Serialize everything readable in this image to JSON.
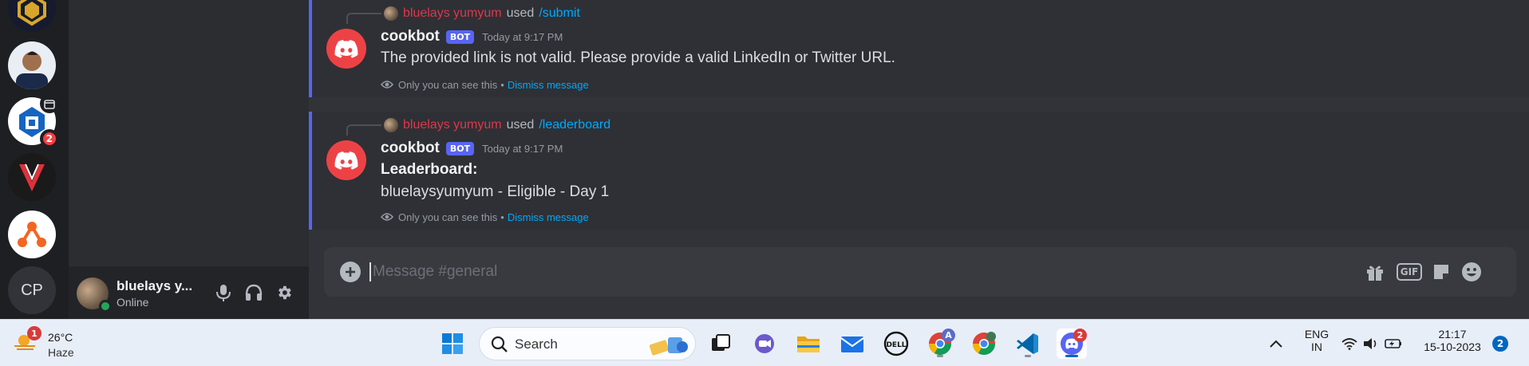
{
  "server_rail": {
    "items": [
      {
        "name": "server-gold-shield"
      },
      {
        "name": "server-profile-photo"
      },
      {
        "name": "server-blue-logo",
        "badge": "2"
      },
      {
        "name": "server-v-logo"
      },
      {
        "name": "server-orange-network"
      },
      {
        "name": "server-cp",
        "initials": "CP"
      }
    ]
  },
  "user_panel": {
    "name": "bluelays y...",
    "status": "Online"
  },
  "messages": [
    {
      "reply_user": "bluelays yumyum",
      "reply_used": "used",
      "reply_command": "/submit",
      "author": "cookbot",
      "bot_tag": "BOT",
      "timestamp": "Today at 9:17 PM",
      "lines": [
        "The provided link is not valid. Please provide a valid LinkedIn or Twitter URL."
      ],
      "ephemeral_note": "Only you can see this",
      "separator": "•",
      "dismiss": "Dismiss message"
    },
    {
      "reply_user": "bluelays yumyum",
      "reply_used": "used",
      "reply_command": "/leaderboard",
      "author": "cookbot",
      "bot_tag": "BOT",
      "timestamp": "Today at 9:17 PM",
      "title": "Leaderboard:",
      "lines": [
        "bluelaysyumyum - Eligible - Day 1"
      ],
      "ephemeral_note": "Only you can see this",
      "separator": "•",
      "dismiss": "Dismiss message"
    }
  ],
  "composer": {
    "placeholder": "Message #general",
    "gif_label": "GIF"
  },
  "taskbar": {
    "weather": {
      "temp": "26°C",
      "condition": "Haze",
      "badge": "1"
    },
    "search_label": "Search",
    "discord_badge": "2",
    "chrome_profile_letter": "A",
    "dell_label": "DELL",
    "language": {
      "line1": "ENG",
      "line2": "IN"
    },
    "clock": {
      "time": "21:17",
      "date": "15-10-2023"
    },
    "notification_count": "2"
  },
  "colors": {
    "blurple": "#5865f2",
    "bot_red": "#ed4245",
    "link_blue": "#00a8fc",
    "reply_user_red": "#e0364b",
    "online_green": "#23a55a"
  }
}
